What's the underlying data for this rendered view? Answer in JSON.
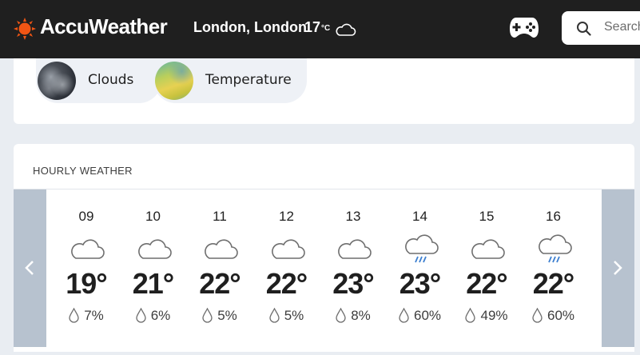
{
  "header": {
    "logo_text": "AccuWeather",
    "logo_icon": "sun-logo-icon",
    "location": "London, London",
    "current_temp": "17",
    "current_temp_unit": "°C",
    "current_icon": "cloud-icon",
    "games_icon": "gamepad-icon",
    "search_placeholder": "Search"
  },
  "map_chips": [
    {
      "label": "Clouds",
      "icon": "clouds-map-thumbnail"
    },
    {
      "label": "Temperature",
      "icon": "temperature-map-thumbnail"
    }
  ],
  "hourly": {
    "title": "HOURLY WEATHER",
    "hours": [
      {
        "time": "09",
        "temp": "19°",
        "precip": "7%",
        "icon": "cloudy"
      },
      {
        "time": "10",
        "temp": "21°",
        "precip": "6%",
        "icon": "cloudy"
      },
      {
        "time": "11",
        "temp": "22°",
        "precip": "5%",
        "icon": "cloudy"
      },
      {
        "time": "12",
        "temp": "22°",
        "precip": "5%",
        "icon": "cloudy"
      },
      {
        "time": "13",
        "temp": "23°",
        "precip": "8%",
        "icon": "cloudy"
      },
      {
        "time": "14",
        "temp": "23°",
        "precip": "60%",
        "icon": "rain-shower"
      },
      {
        "time": "15",
        "temp": "22°",
        "precip": "49%",
        "icon": "cloudy"
      },
      {
        "time": "16",
        "temp": "22°",
        "precip": "60%",
        "icon": "rain-shower"
      }
    ]
  },
  "colors": {
    "header_bg": "#1f1f1f",
    "page_bg": "#e9edf2",
    "logo_orange": "#f05514",
    "rain_blue": "#3d7fd0",
    "arrow_bg": "#b7c2cf"
  }
}
